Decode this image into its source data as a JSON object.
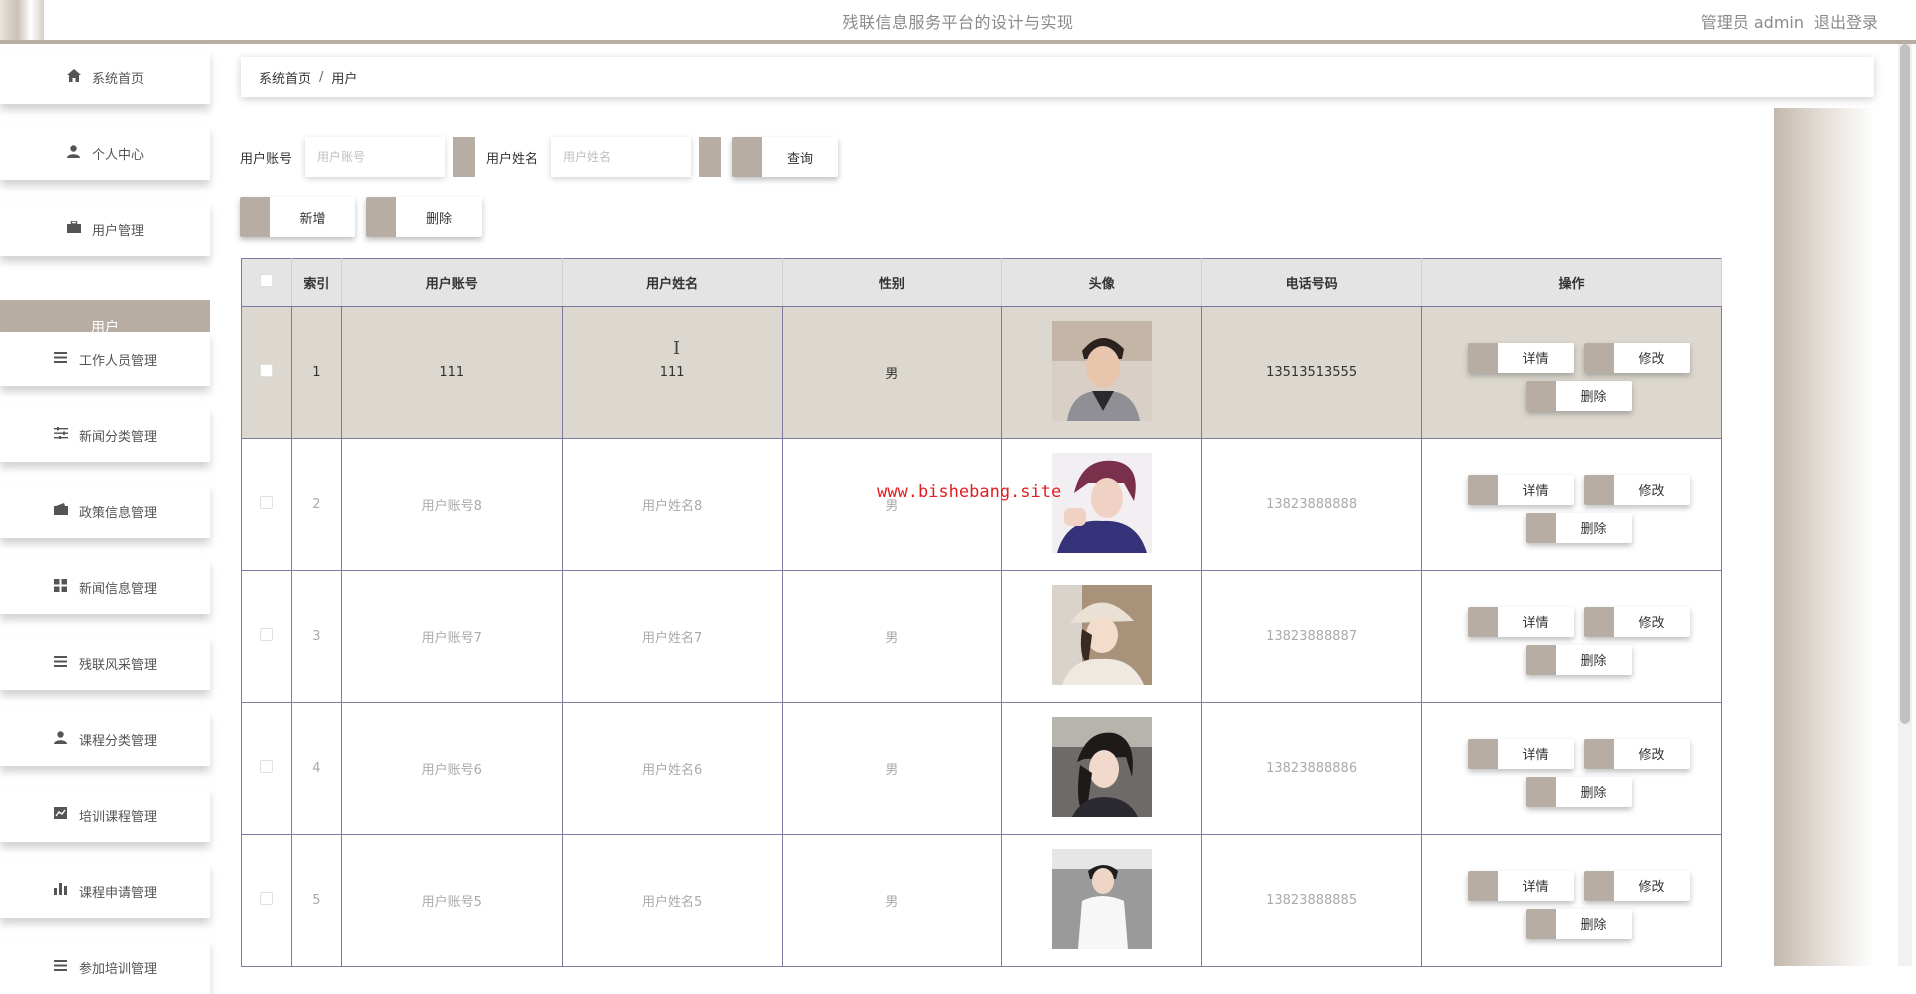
{
  "header": {
    "title": "残联信息服务平台的设计与实现",
    "user": "管理员 admin",
    "logout": "退出登录"
  },
  "sidebar": {
    "items": [
      {
        "label": "系统首页",
        "icon": "home-icon"
      },
      {
        "label": "个人中心",
        "icon": "person-icon"
      },
      {
        "label": "用户管理",
        "icon": "briefcase-icon"
      },
      {
        "label": "工作人员管理",
        "icon": "list-icon"
      },
      {
        "label": "新闻分类管理",
        "icon": "sliders-icon"
      },
      {
        "label": "政策信息管理",
        "icon": "wallet-icon"
      },
      {
        "label": "新闻信息管理",
        "icon": "grid-icon"
      },
      {
        "label": "残联风采管理",
        "icon": "list-icon"
      },
      {
        "label": "课程分类管理",
        "icon": "person-icon"
      },
      {
        "label": "培训课程管理",
        "icon": "line-chart-icon"
      },
      {
        "label": "课程申请管理",
        "icon": "bar-chart-icon"
      },
      {
        "label": "参加培训管理",
        "icon": "list-icon"
      }
    ],
    "active_sub": "用户"
  },
  "breadcrumb": {
    "home": "系统首页",
    "sep": "/",
    "current": "用户"
  },
  "search": {
    "account_label": "用户账号",
    "account_placeholder": "用户账号",
    "name_label": "用户姓名",
    "name_placeholder": "用户姓名",
    "query": "查询"
  },
  "actions": {
    "add": "新增",
    "delete": "删除"
  },
  "table": {
    "headers": [
      "索引",
      "用户账号",
      "用户姓名",
      "性别",
      "头像",
      "电话号码",
      "操作"
    ],
    "rows": [
      {
        "index": "1",
        "account": "111",
        "name": "111",
        "gender": "男",
        "phone": "13513513555"
      },
      {
        "index": "2",
        "account": "用户账号8",
        "name": "用户姓名8",
        "gender": "男",
        "phone": "13823888888"
      },
      {
        "index": "3",
        "account": "用户账号7",
        "name": "用户姓名7",
        "gender": "男",
        "phone": "13823888887"
      },
      {
        "index": "4",
        "account": "用户账号6",
        "name": "用户姓名6",
        "gender": "男",
        "phone": "13823888886"
      },
      {
        "index": "5",
        "account": "用户账号5",
        "name": "用户姓名5",
        "gender": "男",
        "phone": "13823888885"
      }
    ],
    "ops": {
      "detail": "详情",
      "edit": "修改",
      "delete": "删除"
    }
  },
  "watermark": "www.bishebang.site",
  "colors": {
    "accent": "#b8ada3",
    "active_row": "#dcd8d0",
    "watermark": "#e02020"
  }
}
